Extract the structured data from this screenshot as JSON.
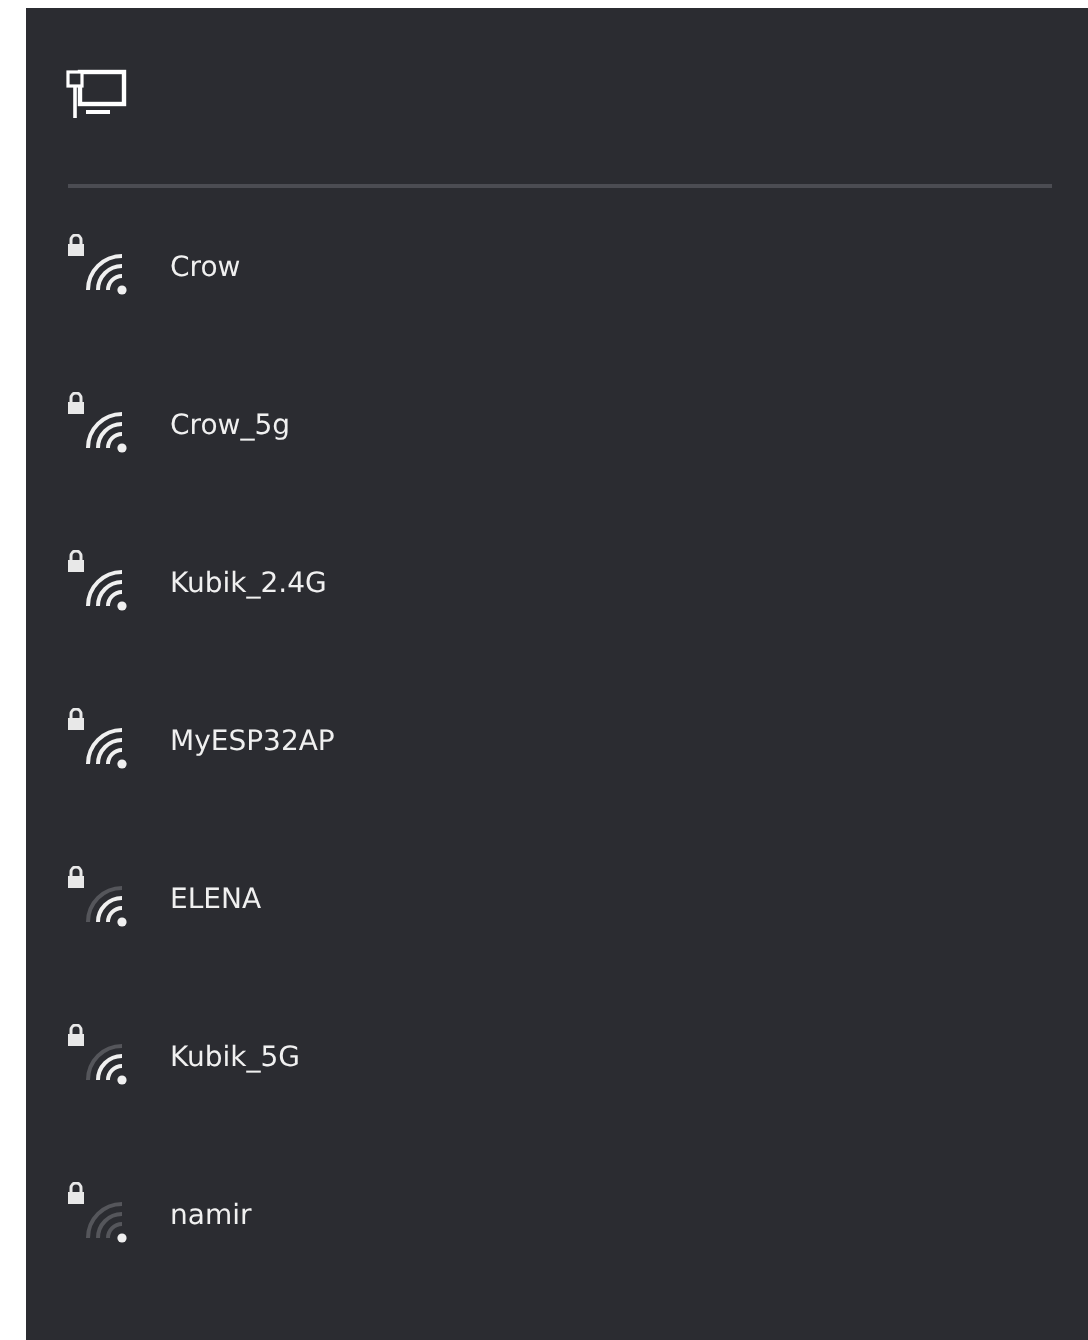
{
  "networks": [
    {
      "name": "Crow",
      "secured": true,
      "kind": "strong"
    },
    {
      "name": "Crow_5g",
      "secured": true,
      "kind": "strong"
    },
    {
      "name": "Kubik_2.4G",
      "secured": true,
      "kind": "strong"
    },
    {
      "name": "MyESP32AP",
      "secured": true,
      "kind": "strong"
    },
    {
      "name": "ELENA",
      "secured": true,
      "kind": "medium"
    },
    {
      "name": "Kubik_5G",
      "secured": true,
      "kind": "medium"
    },
    {
      "name": "namir",
      "secured": true,
      "kind": "weak"
    }
  ]
}
